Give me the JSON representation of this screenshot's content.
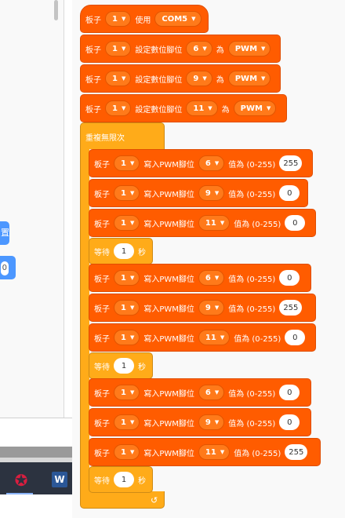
{
  "palette": {
    "chip1_text": "置",
    "chip2_value": "0"
  },
  "taskbar": {
    "word_icon_letter": "W"
  },
  "script": {
    "board_label": "板子",
    "board_value": "1",
    "use_label": "使用",
    "port_value": "COM5",
    "set_pin_label": "設定數位腳位",
    "as_label": "為",
    "mode_value": "PWM",
    "setup_pins": [
      "6",
      "9",
      "11"
    ],
    "forever_label": "重複無限次",
    "write_label": "寫入PWM腳位",
    "value_label": "值為 (0-255)",
    "wait_label": "等待",
    "wait_value": "1",
    "seconds_label": "秒",
    "loop_icon": "↺",
    "groups": [
      {
        "writes": [
          {
            "pin": "6",
            "value": "255"
          },
          {
            "pin": "9",
            "value": "0"
          },
          {
            "pin": "11",
            "value": "0"
          }
        ]
      },
      {
        "writes": [
          {
            "pin": "6",
            "value": "0"
          },
          {
            "pin": "9",
            "value": "255"
          },
          {
            "pin": "11",
            "value": "0"
          }
        ]
      },
      {
        "writes": [
          {
            "pin": "6",
            "value": "0"
          },
          {
            "pin": "9",
            "value": "0"
          },
          {
            "pin": "11",
            "value": "255"
          }
        ]
      }
    ]
  },
  "colors": {
    "arduino_block": "#ff5c00",
    "control_block": "#ffab19",
    "palette_button": "#4c97ff"
  }
}
